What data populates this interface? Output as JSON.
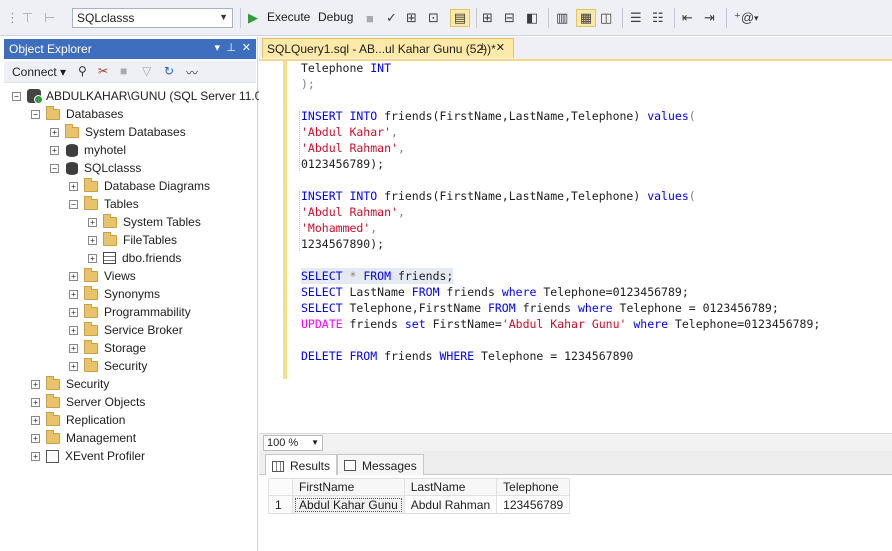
{
  "toolbar": {
    "database": "SQLclasss",
    "execute_label": "Execute",
    "debug_label": "Debug",
    "icons": [
      "filter-icon",
      "database-dropdown",
      "execute-icon",
      "stop-icon",
      "parse-checkmark-icon",
      "display-plan-icon",
      "query-options-icon",
      "results-to-grid-icon",
      "comment-icon",
      "uncomment-icon",
      "indent-icon",
      "outdent-icon",
      "specify-values-icon"
    ]
  },
  "object_explorer": {
    "title": "Object Explorer",
    "connect_label": "Connect",
    "tree": [
      {
        "label": "ABDULKAHAR\\GUNU (SQL Server 11.0.",
        "level": 0,
        "expander": "−",
        "icon": "server"
      },
      {
        "label": "Databases",
        "level": 1,
        "expander": "−",
        "icon": "folder"
      },
      {
        "label": "System Databases",
        "level": 2,
        "expander": "+",
        "icon": "folder"
      },
      {
        "label": "myhotel",
        "level": 2,
        "expander": "+",
        "icon": "database"
      },
      {
        "label": "SQLclasss",
        "level": 2,
        "expander": "−",
        "icon": "database"
      },
      {
        "label": "Database Diagrams",
        "level": 3,
        "expander": "+",
        "icon": "folder"
      },
      {
        "label": "Tables",
        "level": 3,
        "expander": "−",
        "icon": "folder"
      },
      {
        "label": "System Tables",
        "level": 4,
        "expander": "+",
        "icon": "folder"
      },
      {
        "label": "FileTables",
        "level": 4,
        "expander": "+",
        "icon": "folder"
      },
      {
        "label": "dbo.friends",
        "level": 4,
        "expander": "+",
        "icon": "table"
      },
      {
        "label": "Views",
        "level": 3,
        "expander": "+",
        "icon": "folder"
      },
      {
        "label": "Synonyms",
        "level": 3,
        "expander": "+",
        "icon": "folder"
      },
      {
        "label": "Programmability",
        "level": 3,
        "expander": "+",
        "icon": "folder"
      },
      {
        "label": "Service Broker",
        "level": 3,
        "expander": "+",
        "icon": "folder"
      },
      {
        "label": "Storage",
        "level": 3,
        "expander": "+",
        "icon": "folder"
      },
      {
        "label": "Security",
        "level": 3,
        "expander": "+",
        "icon": "folder"
      },
      {
        "label": "Security",
        "level": 1,
        "expander": "+",
        "icon": "folder"
      },
      {
        "label": "Server Objects",
        "level": 1,
        "expander": "+",
        "icon": "folder"
      },
      {
        "label": "Replication",
        "level": 1,
        "expander": "+",
        "icon": "folder"
      },
      {
        "label": "Management",
        "level": 1,
        "expander": "+",
        "icon": "folder"
      },
      {
        "label": "XEvent Profiler",
        "level": 1,
        "expander": "+",
        "icon": "xevent"
      }
    ]
  },
  "editor": {
    "tab_title": "SQLQuery1.sql - AB...ul Kahar Gunu (52))*",
    "lines": [
      [
        {
          "t": "Telephone ",
          "c": ""
        },
        {
          "t": "INT",
          "c": "kw"
        }
      ],
      [
        {
          "t": ");",
          "c": "op"
        }
      ],
      [],
      [
        {
          "t": "INSERT INTO",
          "c": "kw"
        },
        {
          "t": " friends(FirstName,LastName,Telephone) ",
          "c": ""
        },
        {
          "t": "values",
          "c": "kw"
        },
        {
          "t": "(",
          "c": "op"
        }
      ],
      [
        {
          "t": "'Abdul Kahar'",
          "c": "str"
        },
        {
          "t": ",",
          "c": "op"
        }
      ],
      [
        {
          "t": "'Abdul Rahman'",
          "c": "str"
        },
        {
          "t": ",",
          "c": "op"
        }
      ],
      [
        {
          "t": "0123456789);",
          "c": ""
        }
      ],
      [],
      [
        {
          "t": "INSERT INTO",
          "c": "kw"
        },
        {
          "t": " friends(FirstName,LastName,Telephone) ",
          "c": ""
        },
        {
          "t": "values",
          "c": "kw"
        },
        {
          "t": "(",
          "c": "op"
        }
      ],
      [
        {
          "t": "'Abdul Rahman'",
          "c": "str"
        },
        {
          "t": ",",
          "c": "op"
        }
      ],
      [
        {
          "t": "'Mohammed'",
          "c": "str"
        },
        {
          "t": ",",
          "c": "op"
        }
      ],
      [
        {
          "t": "1234567890);",
          "c": ""
        }
      ],
      [],
      [
        {
          "t": "SELECT",
          "c": "kw"
        },
        {
          "t": " * ",
          "c": "op"
        },
        {
          "t": "FROM",
          "c": "kw"
        },
        {
          "t": " friends;",
          "c": ""
        }
      ],
      [
        {
          "t": "SELECT",
          "c": "kw"
        },
        {
          "t": " LastName ",
          "c": ""
        },
        {
          "t": "FROM",
          "c": "kw"
        },
        {
          "t": " friends ",
          "c": ""
        },
        {
          "t": "where",
          "c": "kw"
        },
        {
          "t": " Telephone=0123456789;",
          "c": ""
        }
      ],
      [
        {
          "t": "SELECT",
          "c": "kw"
        },
        {
          "t": " Telephone,FirstName ",
          "c": ""
        },
        {
          "t": "FROM",
          "c": "kw"
        },
        {
          "t": " friends ",
          "c": ""
        },
        {
          "t": "where",
          "c": "kw"
        },
        {
          "t": " Telephone = 0123456789;",
          "c": ""
        }
      ],
      [
        {
          "t": "UPDATE",
          "c": "fn"
        },
        {
          "t": " friends ",
          "c": ""
        },
        {
          "t": "set",
          "c": "kw"
        },
        {
          "t": " FirstName=",
          "c": ""
        },
        {
          "t": "'Abdul Kahar Gunu'",
          "c": "str"
        },
        {
          "t": " ",
          "c": ""
        },
        {
          "t": "where",
          "c": "kw"
        },
        {
          "t": " Telephone=0123456789;",
          "c": ""
        }
      ],
      [],
      [
        {
          "t": "DELETE FROM",
          "c": "kw"
        },
        {
          "t": " friends ",
          "c": ""
        },
        {
          "t": "WHERE",
          "c": "kw"
        },
        {
          "t": " Telephone = 1234567890",
          "c": ""
        }
      ]
    ],
    "selected_line": 13
  },
  "zoom": "100 %",
  "results": {
    "tabs": [
      {
        "label": "Results",
        "active": true
      },
      {
        "label": "Messages",
        "active": false
      }
    ],
    "columns": [
      "FirstName",
      "LastName",
      "Telephone"
    ],
    "rows": [
      {
        "num": "1",
        "cells": [
          "Abdul Kahar Gunu",
          "Abdul Rahman",
          "123456789"
        ]
      }
    ]
  }
}
